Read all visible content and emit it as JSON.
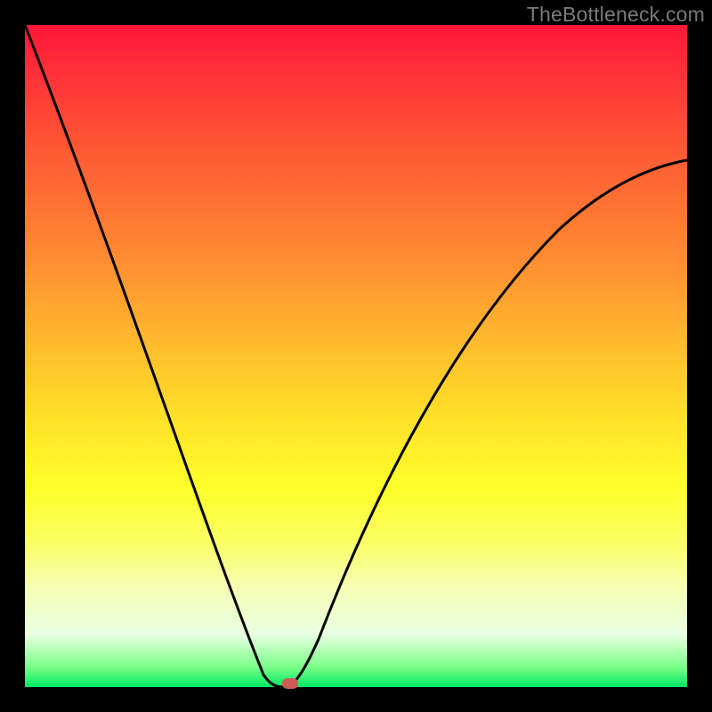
{
  "watermark": "TheBottleneck.com",
  "chart_data": {
    "type": "line",
    "title": "",
    "xlabel": "",
    "ylabel": "",
    "x_range": [
      0,
      1
    ],
    "y_range": [
      0,
      1
    ],
    "minimum_x": 0.39,
    "marker": {
      "x": 0.4,
      "y": 0.005
    },
    "series": [
      {
        "name": "bottleneck-curve",
        "x": [
          0.0,
          0.05,
          0.1,
          0.15,
          0.2,
          0.25,
          0.3,
          0.34,
          0.37,
          0.39,
          0.41,
          0.44,
          0.48,
          0.53,
          0.6,
          0.68,
          0.78,
          0.88,
          1.0
        ],
        "y": [
          1.0,
          0.87,
          0.74,
          0.61,
          0.49,
          0.36,
          0.23,
          0.12,
          0.04,
          0.0,
          0.03,
          0.11,
          0.23,
          0.36,
          0.5,
          0.61,
          0.7,
          0.76,
          0.8
        ]
      }
    ],
    "colors": {
      "curve": "#000000",
      "marker": "#cf5a56",
      "gradient_top": "#ff173a",
      "gradient_bottom": "#00e865",
      "frame": "#000000"
    }
  }
}
